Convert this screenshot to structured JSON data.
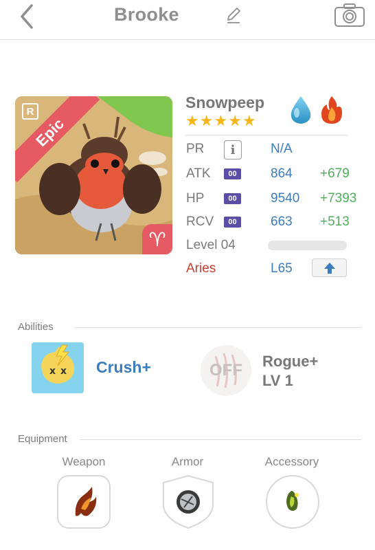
{
  "header": {
    "title": "Brooke"
  },
  "pet": {
    "name": "Snowpeep",
    "rarity_tag": "R",
    "rarity_label": "Epic",
    "zodiac_symbol": "♈",
    "star_count": 5
  },
  "stats": {
    "pr": {
      "label": "PR",
      "value": "N/A"
    },
    "atk": {
      "label": "ATK",
      "badge": "00",
      "value": "864",
      "bonus": "+679"
    },
    "hp": {
      "label": "HP",
      "badge": "00",
      "value": "9540",
      "bonus": "+7393"
    },
    "rcv": {
      "label": "RCV",
      "badge": "00",
      "value": "663",
      "bonus": "+513"
    },
    "level": {
      "label": "Level 04",
      "progress": 0.0
    },
    "sign": {
      "label": "Aries",
      "level": "L65"
    }
  },
  "abilities": {
    "section_title": "Abilities",
    "primary": {
      "name": "Crush+"
    },
    "secondary": {
      "state": "OFF",
      "name_line1": "Rogue+",
      "name_line2": "LV 1"
    }
  },
  "equipment": {
    "section_title": "Equipment",
    "slots": [
      {
        "label": "Weapon"
      },
      {
        "label": "Armor"
      },
      {
        "label": "Accessory"
      }
    ]
  },
  "colors": {
    "accent_blue": "#3d7bbf",
    "bonus_green": "#4fae5a",
    "epic_red": "#e55a63",
    "sign_red": "#c84030",
    "badge_purple": "#5a4ea7",
    "star_gold": "#f7b619"
  }
}
